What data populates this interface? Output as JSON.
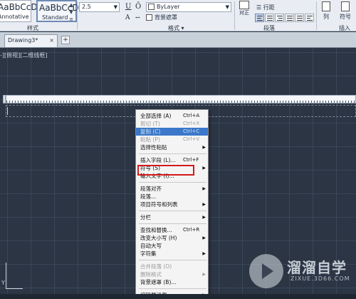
{
  "ribbon": {
    "styles": [
      {
        "sample": "AaBbCcD",
        "name": "Annotative"
      },
      {
        "sample": "AaBbCcD",
        "name": "Standard"
      }
    ],
    "styles_panel_label": "样式",
    "text_height": "2.5",
    "bold_label": "B",
    "italic_label": "I",
    "underline_label": "U",
    "overline_label": "Ō",
    "font_icon_label": "A",
    "color_value": "ByLayer",
    "background_mask_label": "背景遮罩",
    "format_panel_label": "格式 ▾",
    "justify_label": "对正",
    "bullets_label": "行距",
    "paragraph_panel_label": "段落",
    "columns_label": "列",
    "symbol_label": "符号",
    "insert_panel_label": "插入"
  },
  "tabs": {
    "document": "Drawing3*",
    "close": "×",
    "new_tab": "+"
  },
  "viewport": {
    "label": "-][俯视][二维线框]"
  },
  "context_menu": {
    "items": [
      {
        "label": "全部选择 (A)",
        "shortcut": "Ctrl+A",
        "state": "normal"
      },
      {
        "label": "剪切 (T)",
        "shortcut": "Ctrl+X",
        "state": "disabled"
      },
      {
        "label": "复制 (C)",
        "shortcut": "Ctrl+C",
        "state": "highlighted"
      },
      {
        "label": "粘贴 (P)",
        "shortcut": "Ctrl+V",
        "state": "disabled"
      },
      {
        "label": "选择性粘贴",
        "submenu": true,
        "state": "normal"
      },
      {
        "label": "插入字段 (L)...",
        "shortcut": "Ctrl+F",
        "state": "normal"
      },
      {
        "label": "符号 (S)",
        "submenu": true,
        "state": "normal"
      },
      {
        "label": "输入文字 (I)...",
        "state": "normal"
      },
      {
        "label": "段落对齐",
        "submenu": true,
        "state": "normal"
      },
      {
        "label": "段落...",
        "state": "normal"
      },
      {
        "label": "项目符号和列表",
        "submenu": true,
        "state": "normal"
      },
      {
        "label": "分栏",
        "submenu": true,
        "state": "normal"
      },
      {
        "label": "查找和替换...",
        "shortcut": "Ctrl+R",
        "state": "normal"
      },
      {
        "label": "改变大小写 (H)",
        "submenu": true,
        "state": "normal"
      },
      {
        "label": "自动大写",
        "state": "normal"
      },
      {
        "label": "字符集",
        "submenu": true,
        "state": "normal"
      },
      {
        "label": "合并段落 (O)",
        "state": "disabled"
      },
      {
        "label": "删除格式",
        "submenu": true,
        "state": "disabled"
      },
      {
        "label": "背景遮罩 (B)...",
        "state": "normal"
      },
      {
        "label": "编辑器设置",
        "submenu": true,
        "state": "normal"
      }
    ]
  },
  "ucs": {
    "y_label": "Y"
  },
  "watermark": {
    "title": "溜溜自学",
    "url": "ZIXUE.3D66.COM"
  }
}
